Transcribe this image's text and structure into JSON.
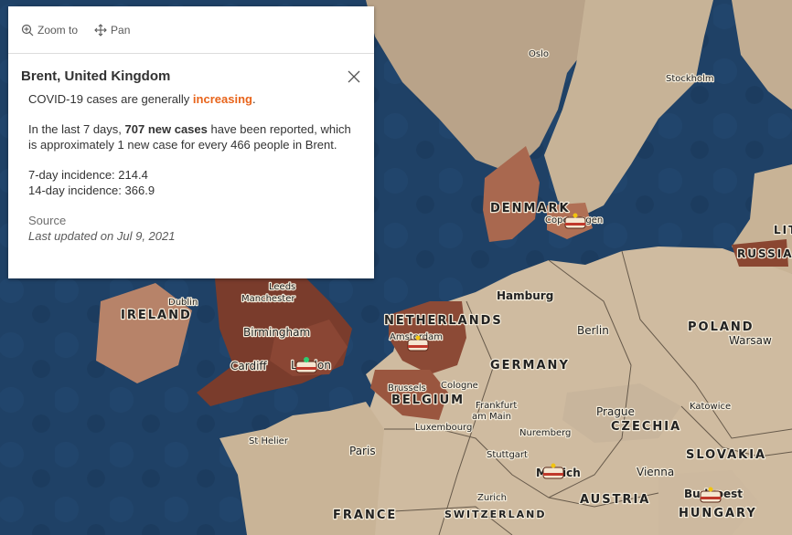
{
  "popup": {
    "toolbar": {
      "zoom_label": "Zoom to",
      "pan_label": "Pan"
    },
    "title": "Brent, United Kingdom",
    "trend_prefix": "COVID-19 cases are generally ",
    "trend_word": "increasing",
    "trend_suffix": ".",
    "trend_color": "#e8641b",
    "cases_prefix": "In the last 7 days, ",
    "cases_bold": "707 new cases",
    "cases_suffix": " have been reported, which is approximately 1 new case for every 466 people in Brent.",
    "incidence_7": "7-day incidence: 214.4",
    "incidence_14": "14-day incidence: 366.9",
    "source_label": "Source",
    "updated": "Last updated on Jul 9, 2021"
  },
  "map": {
    "countries": {
      "denmark": "DENMARK",
      "netherlands": "NETHERLANDS",
      "belgium": "BELGIUM",
      "germany": "GERMANY",
      "poland": "POLAND",
      "czechia": "CZECHIA",
      "slovakia": "SLOVAKIA",
      "austria": "AUSTRIA",
      "hungary": "HUNGARY",
      "france": "FRANCE",
      "switzerland": "SWITZERLAND",
      "ireland": "IRELAND",
      "russia": "RUSSIA",
      "lit": "LIT"
    },
    "cities": {
      "oslo": "Oslo",
      "stockholm": "Stockholm",
      "copenhagen": "Copenhagen",
      "hamburg": "Hamburg",
      "berlin": "Berlin",
      "warsaw": "Warsaw",
      "amsterdam": "Amsterdam",
      "brussels": "Brussels",
      "cologne": "Cologne",
      "frankfurt": "Frankfurt\nam Main",
      "luxembourg": "Luxembourg",
      "nuremberg": "Nuremberg",
      "stuttgart": "Stuttgart",
      "munich": "Munich",
      "zurich": "Zurich",
      "vienna": "Vienna",
      "budapest": "Budapest",
      "prague": "Prague",
      "katowice": "Katowice",
      "paris": "Paris",
      "sthelier": "St Helier",
      "london": "London",
      "cardiff": "Cardiff",
      "birmingham": "Birmingham",
      "manchester": "Manchester",
      "leeds": "Leeds",
      "dublin": "Dublin"
    },
    "colors": {
      "sea": "#1e3f63",
      "land": "#cdb89c",
      "uk_high": "#7a3c2c",
      "moderate": "#a0614c",
      "light": "#c89a82"
    }
  }
}
